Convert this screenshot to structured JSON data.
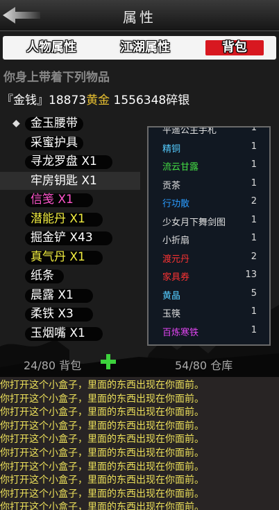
{
  "header": {
    "title": "属性"
  },
  "tabs": [
    {
      "label": "人物属性"
    },
    {
      "label": "江湖属性"
    },
    {
      "label": "背包",
      "active": true
    }
  ],
  "carry_label": "你身上带着下列物品",
  "money": {
    "prefix": "『金钱』",
    "gold_amount": "18873",
    "gold_unit": "黄金",
    "silver_amount": "1556348",
    "silver_unit": "碎银"
  },
  "bag_items": [
    {
      "name": "金玉腰带",
      "color": "#ffffff",
      "equipped": true
    },
    {
      "name": "采蜜护具",
      "color": "#ffffff"
    },
    {
      "name": "寻龙罗盘 X1",
      "color": "#ffffff"
    },
    {
      "name": "牢房钥匙 X1",
      "color": "#ffffff",
      "selected": true
    },
    {
      "name": "信笺 X1",
      "color": "#ff55cc"
    },
    {
      "name": "潜能丹 X1",
      "color": "#f2ee40"
    },
    {
      "name": "掘金铲 X43",
      "color": "#ffffff"
    },
    {
      "name": "真气丹 X1",
      "color": "#f2ee40"
    },
    {
      "name": "纸条",
      "color": "#ffffff"
    },
    {
      "name": "晨露 X1",
      "color": "#ffffff"
    },
    {
      "name": "柔铁 X3",
      "color": "#ffffff"
    },
    {
      "name": "玉烟嘴 X1",
      "color": "#ffffff"
    }
  ],
  "store_items": [
    {
      "name": "平遥公主手札",
      "count": "1",
      "color": "#e0e0e0"
    },
    {
      "name": "精铜",
      "count": "1",
      "color": "#55ccff"
    },
    {
      "name": "流云甘露",
      "count": "1",
      "color": "#44dd44"
    },
    {
      "name": "贡茶",
      "count": "1",
      "color": "#e0e0e0"
    },
    {
      "name": "行功散",
      "count": "2",
      "color": "#2a9cff"
    },
    {
      "name": "少女月下舞剑图",
      "count": "1",
      "color": "#e0e0e0"
    },
    {
      "name": "小折扇",
      "count": "1",
      "color": "#e0e0e0"
    },
    {
      "name": "渡元丹",
      "count": "2",
      "color": "#ff3333"
    },
    {
      "name": "家具券",
      "count": "13",
      "color": "#ff3333"
    },
    {
      "name": "黄晶",
      "count": "5",
      "color": "#55ccff"
    },
    {
      "name": "玉筷",
      "count": "1",
      "color": "#e0e0e0"
    },
    {
      "name": "百炼寒铁",
      "count": "1",
      "color": "#dd44ee"
    }
  ],
  "bag_count": "24/80 背包",
  "store_count": "54/80 仓库",
  "log_lines": [
    "你打开这个小盒子，里面的东西出现在你面前。",
    "你打开这个小盒子，里面的东西出现在你面前。",
    "你打开这个小盒子，里面的东西出现在你面前。",
    "你打开这个小盒子，里面的东西出现在你面前。",
    "你打开这个小盒子，里面的东西出现在你面前。",
    "你打开这个小盒子，里面的东西出现在你面前。",
    "你打开这个小盒子，里面的东西出现在你面前。",
    "你打开这个小盒子，里面的东西出现在你面前。",
    "你打开这个小盒子，里面的东西出现在你面前。",
    "你打开这个小盒子，里面的东西出现在你面前。"
  ],
  "colors": {
    "gold": "#e8c030",
    "tab_active": "#d81820",
    "log_text": "#ece05a",
    "plus": "#3cd23c"
  }
}
